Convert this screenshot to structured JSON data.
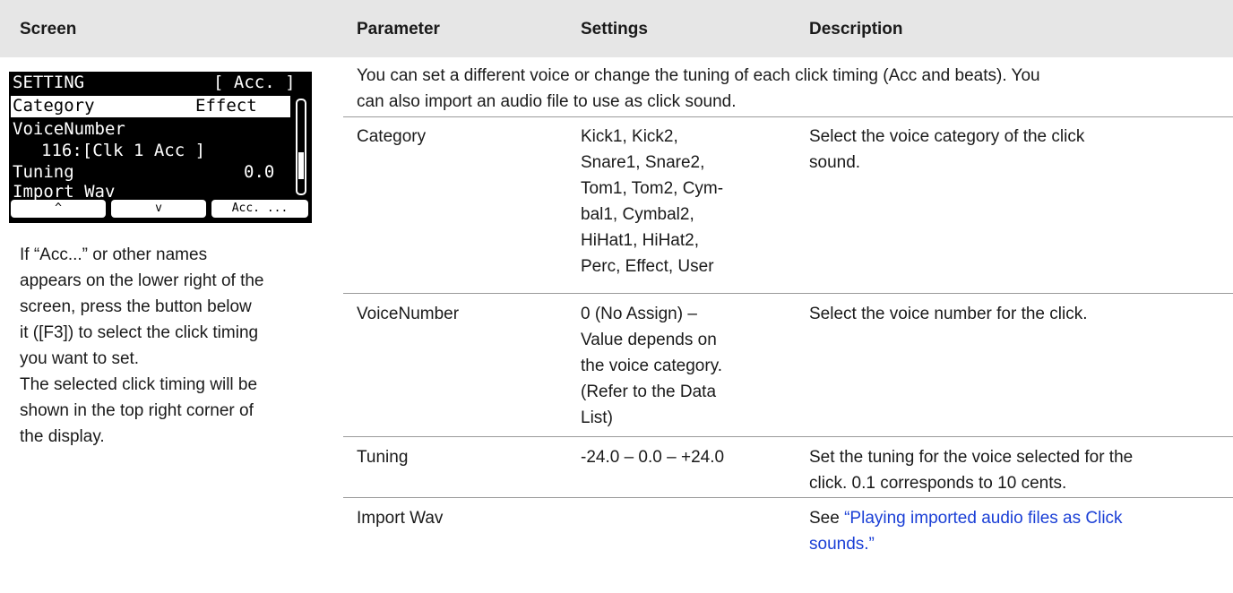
{
  "header": {
    "screen": "Screen",
    "parameter": "Parameter",
    "settings": "Settings",
    "description": "Description"
  },
  "lcd": {
    "title": "SETTING",
    "timing": "[ Acc. ]",
    "category_label": "Category",
    "category_value": "Effect",
    "voice_label": "VoiceNumber",
    "voice_value": "116:[Clk 1 Acc ]",
    "tuning_label": "Tuning",
    "tuning_value": "0.0",
    "import_label": "Import Wav",
    "f1": "^",
    "f2": "v",
    "f3": "Acc. ..."
  },
  "screen_note": [
    "If “Acc...” or other names",
    "appears on the lower right of the",
    "screen, press the button below",
    "it ([F3]) to select the click timing",
    "you want to set.",
    "The selected click timing will be",
    "shown in the top right corner of",
    "the display."
  ],
  "intro": [
    "You can set a different voice or change the tuning of each click timing (Acc and beats). You",
    "can also import an audio file to use as click sound."
  ],
  "rows": [
    {
      "parameter": "Category",
      "settings": [
        "Kick1, Kick2,",
        "Snare1, Snare2,",
        "Tom1, Tom2, Cym-",
        "bal1, Cymbal2,",
        "HiHat1, HiHat2,",
        "Perc, Effect, User"
      ],
      "description": [
        "Select the voice category of the click",
        "sound."
      ]
    },
    {
      "parameter": "VoiceNumber",
      "settings": [
        "0 (No Assign) –",
        "Value depends on",
        "the voice category.",
        "(Refer to the Data",
        "List)"
      ],
      "description": [
        "Select the voice number for the click."
      ]
    },
    {
      "parameter": "Tuning",
      "settings": [
        "-24.0 – 0.0 – +24.0"
      ],
      "description": [
        "Set the tuning for the voice selected for the",
        "click. 0.1 corresponds to 10 cents."
      ]
    },
    {
      "parameter": "Import Wav",
      "settings": [],
      "description": [
        "See",
        "“Playing imported audio files as Click",
        "sounds.”"
      ]
    }
  ]
}
